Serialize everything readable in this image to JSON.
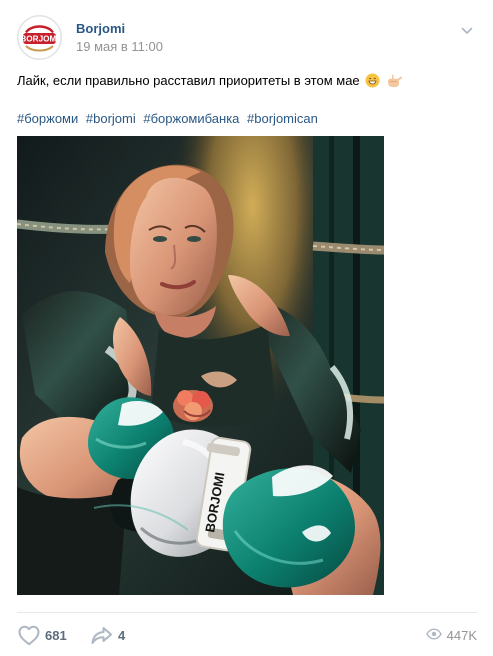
{
  "post": {
    "author": "Borjomi",
    "date": "19 мая в 11:00",
    "text": "Лайк, если правильно расставил приоритеты в этом мае",
    "hashtags": [
      "#боржоми",
      "#borjomi",
      "#боржомибанка",
      "#borjomican"
    ],
    "photo_text": "BORJOMI"
  },
  "avatar": {
    "logo_text": "BORJOMI"
  },
  "actions": {
    "likes": "681",
    "shares": "4",
    "views": "447K"
  },
  "icons": {
    "more": "chevron-down-icon",
    "like": "heart-icon",
    "share": "share-icon",
    "views": "eye-icon",
    "emoji1": "grin-icon",
    "emoji2": "call-me-hand-icon"
  },
  "colors": {
    "link": "#2a5885",
    "muted": "#939393",
    "divider": "#e7e8ec",
    "brand_red": "#c7202c",
    "brand_gold": "#c69b4a",
    "teal": "#0d8f7e"
  }
}
